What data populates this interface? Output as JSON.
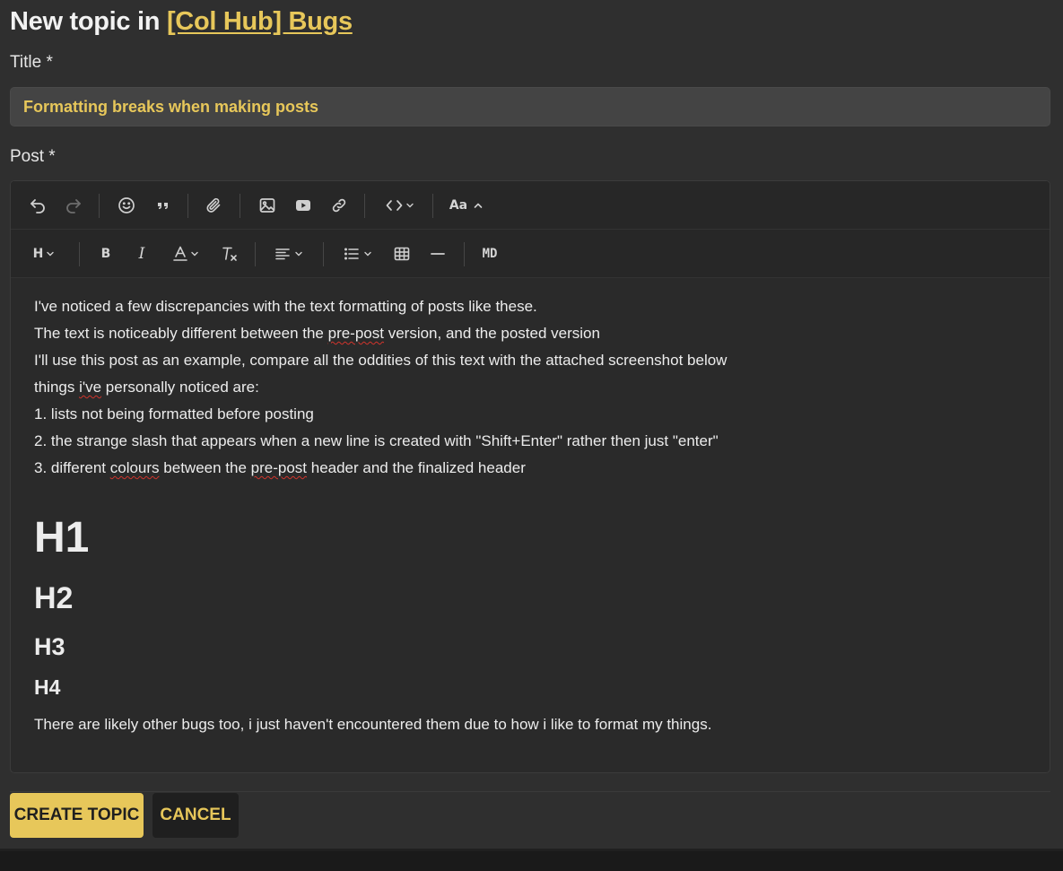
{
  "header": {
    "prefix": "New topic in ",
    "category": "[Col Hub] Bugs"
  },
  "title_field": {
    "label": "Title *",
    "value": "Formatting breaks when making posts"
  },
  "post_field": {
    "label": "Post *"
  },
  "toolbar": {
    "row1": [
      {
        "icon": "undo-icon"
      },
      {
        "icon": "redo-icon"
      },
      {
        "icon": "emoji-icon"
      },
      {
        "icon": "quote-icon"
      },
      {
        "icon": "paperclip-icon"
      },
      {
        "icon": "image-icon"
      },
      {
        "icon": "video-icon"
      },
      {
        "icon": "link-icon"
      },
      {
        "icon": "code-icon"
      },
      {
        "icon": "font-size-icon",
        "label": "Aa"
      }
    ],
    "row2": [
      {
        "icon": "heading-icon",
        "label": "H"
      },
      {
        "icon": "bold-icon",
        "label": "B"
      },
      {
        "icon": "italic-icon",
        "label": "I"
      },
      {
        "icon": "text-color-icon"
      },
      {
        "icon": "clear-format-icon"
      },
      {
        "icon": "align-icon"
      },
      {
        "icon": "list-icon"
      },
      {
        "icon": "table-icon"
      },
      {
        "icon": "horizontal-rule-icon"
      },
      {
        "icon": "markdown-icon",
        "label": "MD"
      }
    ]
  },
  "body": {
    "line1": "I've noticed a few discrepancies with the text formatting of posts like these.",
    "line2_before": "The text is noticeably different between the ",
    "line2_word": "pre-post",
    "line2_after": " version, and the posted version",
    "line3": "I'll use this post as an example, compare all the oddities of this text with the attached screenshot below",
    "line4_before": "things ",
    "line4_word": "i've",
    "line4_after": " personally noticed are:",
    "line5": "1. lists not being formatted before posting",
    "line6": "2. the strange slash that appears when a new line is created with \"Shift+Enter\" rather then just \"enter\"",
    "line7_before": "3. different ",
    "line7_word1": "colours",
    "line7_middle": " between the ",
    "line7_word2": "pre-post",
    "line7_after": " header and the finalized header",
    "h1": "H1",
    "h2": "H2",
    "h3": "H3",
    "h4": "H4",
    "last": "There are likely other bugs too, i just haven't encountered them due to how i like to format my things."
  },
  "actions": {
    "create": "CREATE TOPIC",
    "cancel": "CANCEL"
  },
  "colors": {
    "accent": "#e7c75a",
    "background": "#2f2f2f",
    "editor": "#2a2a2a"
  }
}
